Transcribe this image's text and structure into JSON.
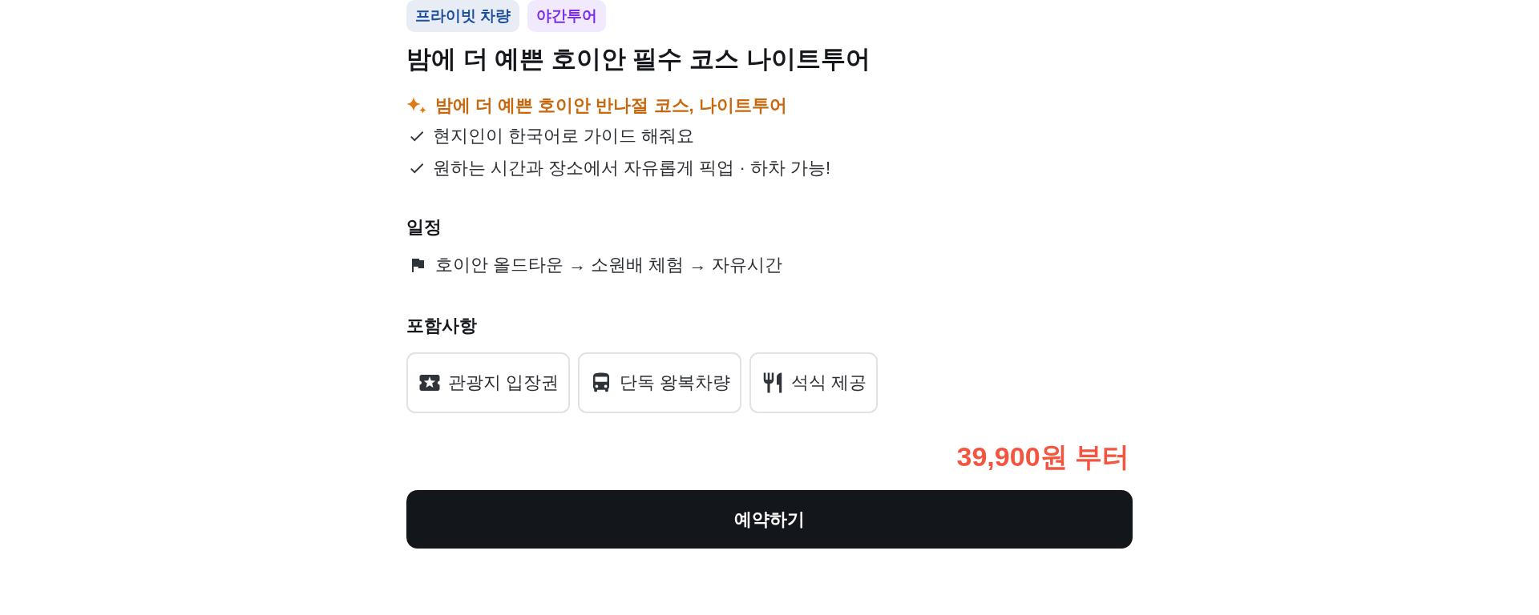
{
  "tags": [
    {
      "label": "프라이빗 차량",
      "color": "#1d4e9e"
    },
    {
      "label": "야간투어",
      "color": "#7a2cf0"
    }
  ],
  "title": "밤에 더 예쁜 호이안 필수 코스 나이트투어",
  "highlight": "밤에 더 예쁜 호이안 반나절 코스, 나이트투어",
  "features": [
    "현지인이 한국어로 가이드 해줘요",
    "원하는 시간과 장소에서 자유롭게 픽업 · 하차 가능!"
  ],
  "schedule": {
    "heading": "일정",
    "route": "호이안 올드타운 → 소원배 체험 → 자유시간"
  },
  "inclusions": {
    "heading": "포함사항",
    "items": [
      {
        "label": "관광지 입장권",
        "kind": "ticket"
      },
      {
        "label": "단독 왕복차량",
        "kind": "bus"
      },
      {
        "label": "석식 제공",
        "kind": "meal"
      }
    ]
  },
  "price": "39,900원 부터",
  "button": "예약하기"
}
